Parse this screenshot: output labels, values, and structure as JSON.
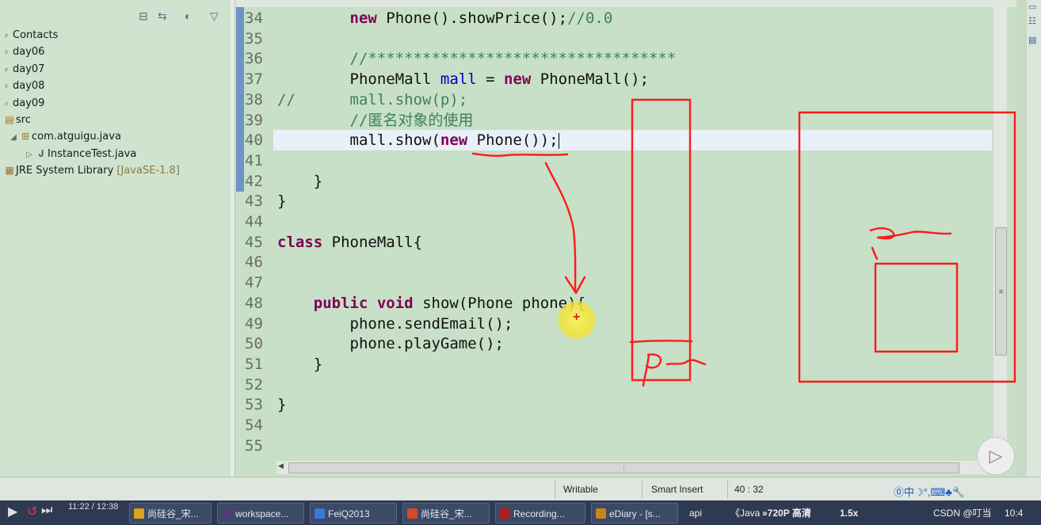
{
  "package_explorer": {
    "items": [
      {
        "label": "Contacts",
        "icon": "project-icon"
      },
      {
        "label": "day06",
        "icon": "project-icon"
      },
      {
        "label": "day07",
        "icon": "project-icon"
      },
      {
        "label": "day08",
        "icon": "project-icon"
      },
      {
        "label": "day09",
        "icon": "project-icon"
      },
      {
        "label": "src",
        "icon": "source-folder-icon"
      },
      {
        "label": "com.atguigu.java",
        "icon": "package-icon"
      },
      {
        "label": "InstanceTest.java",
        "icon": "java-file-icon"
      },
      {
        "label": "JRE System Library",
        "suffix": "[JavaSE-1.8]",
        "icon": "library-icon"
      }
    ]
  },
  "editor": {
    "line_numbers": [
      "34",
      "35",
      "36",
      "37",
      "38",
      "39",
      "40",
      "41",
      "42",
      "43",
      "44",
      "45",
      "46",
      "47",
      "48",
      "49",
      "50",
      "51",
      "52",
      "53",
      "54",
      "55"
    ],
    "lines": {
      "l34_indent": "        ",
      "l34_kw": "new",
      "l34_code": " Phone().showPrice();",
      "l34_comment": "//0.0",
      "l36_comment": "        //**********************************",
      "l37_pre": "        PhoneMall ",
      "l37_field": "mall",
      "l37_mid": " = ",
      "l37_kw": "new",
      "l37_post": " PhoneMall();",
      "l38_comment_prefix": "//",
      "l38_comment_body": "      mall.show(p);",
      "l39_comment": "        //匿名对象的使用",
      "l40_pre": "        mall.show(",
      "l40_kw": "new",
      "l40_post": " Phone());",
      "l42": "    }",
      "l43": "}",
      "l45_kw": "class",
      "l45_post": " PhoneMall{",
      "l48_kw1": "public",
      "l48_kw2": "void",
      "l48_post": " show(Phone phone){",
      "l49": "        phone.sendEmail();",
      "l50": "        phone.playGame();",
      "l51": "    }",
      "l53": "}"
    },
    "current_line": "40"
  },
  "status_bar": {
    "mode": "Writable",
    "insert": "Smart Insert",
    "position": "40 : 32"
  },
  "taskbar": {
    "time_left": "11:22 / 12:38",
    "items": [
      {
        "label": "尚硅谷_宋..."
      },
      {
        "label": "workspace..."
      },
      {
        "label": "FeiQ2013"
      },
      {
        "label": "尚硅谷_宋..."
      },
      {
        "label": "Recording..."
      },
      {
        "label": "eDiary - [s..."
      },
      {
        "label": "api"
      },
      {
        "label": "《Java"
      }
    ],
    "tray_quality": "»720P 高清",
    "tray_speed": "1.5x",
    "tray_csdn": "CSDN @叮当",
    "tray_time": "10:4"
  },
  "colors": {
    "editor_bg": "#c7e0c7",
    "explorer_bg": "#cfe3cf",
    "annotation_red": "#ff1a1a",
    "keyword": "#7f0055",
    "comment": "#3f7f5f",
    "field": "#0000c0"
  }
}
